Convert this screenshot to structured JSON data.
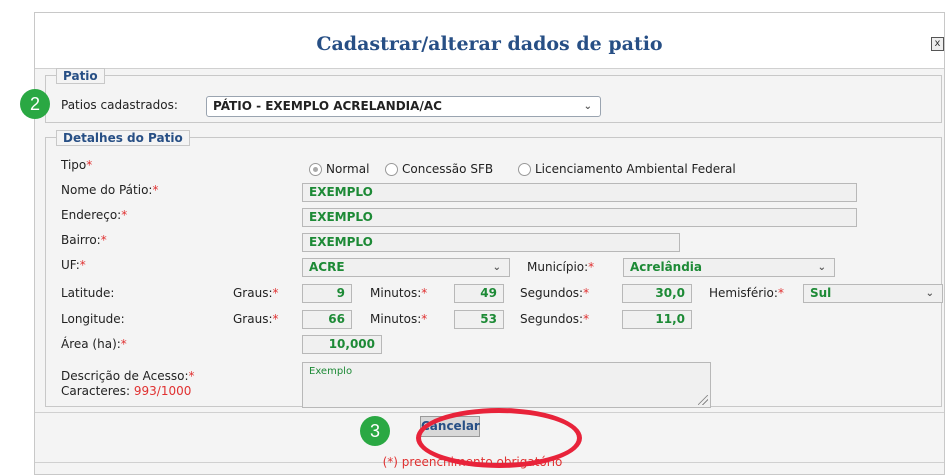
{
  "dialog": {
    "title": "Cadastrar/alterar dados de patio",
    "close_glyph": "x"
  },
  "patio_section": {
    "legend": "Patio",
    "label": "Patios cadastrados:",
    "selected": "PÁTIO - EXEMPLO ACRELANDIA/AC"
  },
  "details": {
    "legend": "Detalhes do Patio",
    "tipo": {
      "label": "Tipo",
      "options": [
        "Normal",
        "Concessão SFB",
        "Licenciamento Ambiental Federal"
      ],
      "selected_index": 0
    },
    "nome": {
      "label": "Nome do Pátio:",
      "value": "EXEMPLO"
    },
    "endereco": {
      "label": "Endereço:",
      "value": "EXEMPLO"
    },
    "bairro": {
      "label": "Bairro:",
      "value": "EXEMPLO"
    },
    "uf": {
      "label": "UF:",
      "value": "ACRE"
    },
    "municipio": {
      "label": "Município:",
      "value": "Acrelândia"
    },
    "latitude": {
      "label": "Latitude:",
      "graus_label": "Graus:",
      "graus": "9",
      "minutos_label": "Minutos:",
      "minutos": "49",
      "segundos_label": "Segundos:",
      "segundos": "30,0",
      "hemisferio_label": "Hemisfério:",
      "hemisferio": "Sul"
    },
    "longitude": {
      "label": "Longitude:",
      "graus_label": "Graus:",
      "graus": "66",
      "minutos_label": "Minutos:",
      "minutos": "53",
      "segundos_label": "Segundos:",
      "segundos": "11,0"
    },
    "area": {
      "label": "Área (ha):",
      "value": "10,000"
    },
    "descricao": {
      "label": "Descrição de Acesso:",
      "chars_label": "Caracteres:",
      "chars_count": "993/1000",
      "value": "Exemplo"
    }
  },
  "required_mark": "*",
  "actions": {
    "cancel_label": "Cancelar"
  },
  "footer": {
    "note": "(*) preenchimento obrigatório"
  },
  "annotations": {
    "step2": "2",
    "step3": "3"
  },
  "colors": {
    "title": "#274f85",
    "value_green": "#1d8a36",
    "required_red": "#e03030",
    "badge_green": "#2aa843",
    "highlight_red": "#e8233a"
  }
}
